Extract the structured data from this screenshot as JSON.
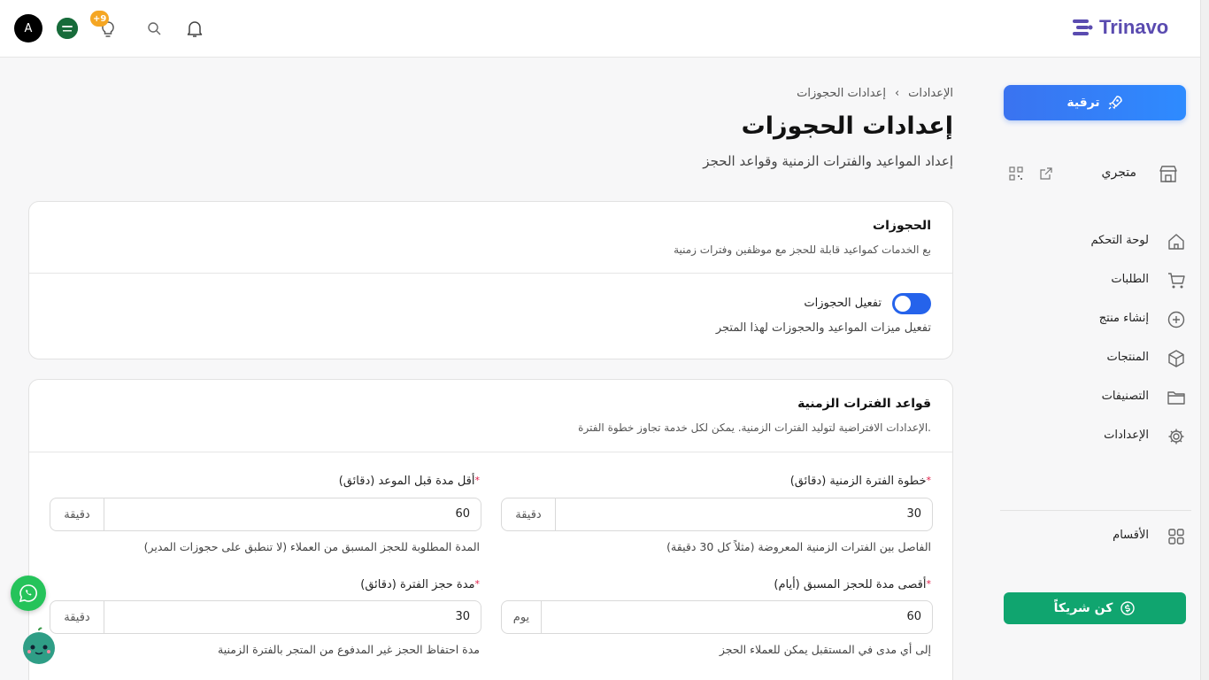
{
  "header": {
    "logo_text": "Trinavo",
    "avatar_letter": "A",
    "notification_badge": "+9"
  },
  "sidebar": {
    "upgrade_label": "ترقية",
    "store_label": "متجري",
    "items": [
      {
        "label": "لوحة التحكم",
        "icon": "home-icon"
      },
      {
        "label": "الطلبات",
        "icon": "cart-icon"
      },
      {
        "label": "إنشاء منتج",
        "icon": "plus-circle-icon"
      },
      {
        "label": "المنتجات",
        "icon": "box-icon"
      },
      {
        "label": "التصنيفات",
        "icon": "folder-icon"
      },
      {
        "label": "الإعدادات",
        "icon": "gear-icon"
      }
    ],
    "sections_label": "الأقسام",
    "partner_label": "كن شريكاً"
  },
  "breadcrumb": {
    "root": "الإعدادات",
    "separator": "›",
    "current": "إعدادات الحجوزات"
  },
  "page": {
    "title": "إعدادات الحجوزات",
    "subtitle": "إعداد المواعيد والفترات الزمنية وقواعد الحجز"
  },
  "bookings_card": {
    "title": "الحجوزات",
    "subtitle": "بع الخدمات كمواعيد قابلة للحجز مع موظفين وفترات زمنية",
    "toggle_label": "تفعيل الحجوزات",
    "toggle_on": true,
    "toggle_desc": "تفعيل ميزات المواعيد والحجوزات لهذا المتجر"
  },
  "slots_card": {
    "title": "قواعد الفترات الزمنية",
    "subtitle": "الإعدادات الافتراضية لتوليد الفترات الزمنية. يمكن لكل خدمة تجاوز خطوة الفترة.",
    "required_mark": "*",
    "fields": {
      "slot_step": {
        "label": "خطوة الفترة الزمنية (دقائق)",
        "value": "30",
        "unit": "دقيقة",
        "help": "الفاصل بين الفترات الزمنية المعروضة (مثلاً كل 30 دقيقة)"
      },
      "min_lead": {
        "label": "أقل مدة قبل الموعد (دقائق)",
        "value": "60",
        "unit": "دقيقة",
        "help": "المدة المطلوبة للحجز المسبق من العملاء (لا تنطبق على حجوزات المدير)"
      },
      "max_advance": {
        "label": "أقصى مدة للحجز المسبق (أيام)",
        "value": "60",
        "unit": "يوم",
        "help": "إلى أي مدى في المستقبل يمكن للعملاء الحجز"
      },
      "hold_duration": {
        "label": "مدة حجز الفترة (دقائق)",
        "value": "30",
        "unit": "دقيقة",
        "help": "مدة احتفاظ الحجز غير المدفوع من المتجر بالفترة الزمنية"
      }
    }
  },
  "colors": {
    "accent": "#2563eb",
    "partner": "#10a56f",
    "whatsapp": "#25c35a",
    "badge": "#f5a623"
  }
}
